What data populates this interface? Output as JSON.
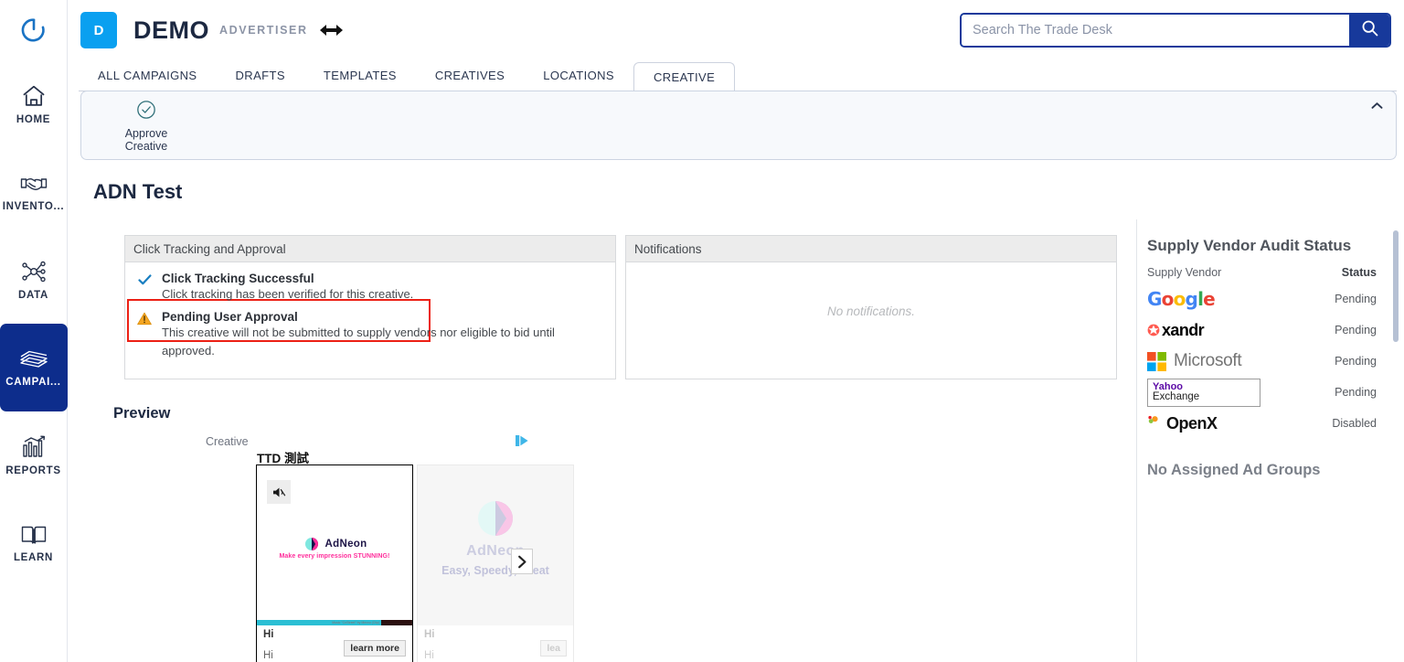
{
  "sidebar": {
    "items": [
      {
        "label": "HOME",
        "icon": "home-icon",
        "active": false
      },
      {
        "label": "INVENTO...",
        "icon": "handshake-icon",
        "active": false
      },
      {
        "label": "DATA",
        "icon": "data-nodes-icon",
        "active": false
      },
      {
        "label": "CAMPAI...",
        "icon": "campaign-stack-icon",
        "active": true
      },
      {
        "label": "REPORTS",
        "icon": "bar-chart-icon",
        "active": false
      },
      {
        "label": "LEARN",
        "icon": "open-book-icon",
        "active": false
      }
    ]
  },
  "header": {
    "badge_letter": "D",
    "brand": "DEMO",
    "brand_subtitle": "ADVERTISER",
    "switch_icon": "double-arrow-icon",
    "search": {
      "placeholder": "Search The Trade Desk",
      "value": "",
      "icon": "search-icon"
    }
  },
  "tabs": [
    {
      "label": "ALL CAMPAIGNS",
      "active": false
    },
    {
      "label": "DRAFTS",
      "active": false
    },
    {
      "label": "TEMPLATES",
      "active": false
    },
    {
      "label": "CREATIVES",
      "active": false
    },
    {
      "label": "LOCATIONS",
      "active": false
    },
    {
      "label": "CREATIVE",
      "active": true
    }
  ],
  "action_bar": {
    "approve": {
      "label_line1": "Approve",
      "label_line2": "Creative",
      "icon": "check-circle-icon"
    },
    "collapse_icon": "chevron-up-icon"
  },
  "page": {
    "title": "ADN Test"
  },
  "click_panel": {
    "header": "Click Tracking and Approval",
    "rows": [
      {
        "icon": "check-icon",
        "title": "Click Tracking Successful",
        "desc": "Click tracking has been verified for this creative.",
        "highlighted": true
      },
      {
        "icon": "warning-triangle-icon",
        "title": "Pending User Approval",
        "desc": "This creative will not be submitted to supply vendors nor eligible to bid until approved.",
        "highlighted": false
      }
    ],
    "highlight_color": "#ec2015"
  },
  "notifications_panel": {
    "header": "Notifications",
    "empty_text": "No notifications."
  },
  "preview": {
    "title": "Preview",
    "creative_label": "Creative",
    "adchoices_icon": "adchoices-icon",
    "ad_title": "TTD 測試",
    "next_icon": "chevron-right-icon",
    "cards": [
      {
        "mute_icon": "mute-speaker-icon",
        "logo_text": "AdNeon",
        "tagline": "Make every impression STUNNING!",
        "progress_text": "Music \"CnStreet\" by Mexxu (Clip)",
        "footer_line1": "Hi",
        "footer_line2": "Hi",
        "cta": "learn more"
      },
      {
        "logo_text": "AdNeon",
        "tagline": "Easy, Speedy, Creat",
        "footer_line1": "Hi",
        "footer_line2": "Hi",
        "cta": "lea"
      }
    ]
  },
  "right_panel": {
    "title": "Supply Vendor Audit Status",
    "col_vendor": "Supply Vendor",
    "col_status": "Status",
    "vendors": [
      {
        "name": "Google",
        "logo": "google-logo",
        "status": "Pending"
      },
      {
        "name": "xandr",
        "logo": "xandr-logo",
        "status": "Pending"
      },
      {
        "name": "Microsoft",
        "logo": "microsoft-logo",
        "status": "Pending"
      },
      {
        "name": "Yahoo Exchange",
        "logo": "yahoo-exchange-logo",
        "status": "Pending",
        "line1": "Yahoo",
        "line2": "Exchange"
      },
      {
        "name": "OpenX",
        "logo": "openx-logo",
        "status": "Disabled"
      }
    ],
    "no_adgroups": "No Assigned Ad Groups"
  },
  "colors": {
    "brand_blue": "#0aa0f0",
    "nav_active": "#0d2d8c",
    "search_border": "#17399b",
    "alert_red": "#ec2015",
    "warning_amber": "#f5a623",
    "success_blue": "#1a7fc1"
  }
}
